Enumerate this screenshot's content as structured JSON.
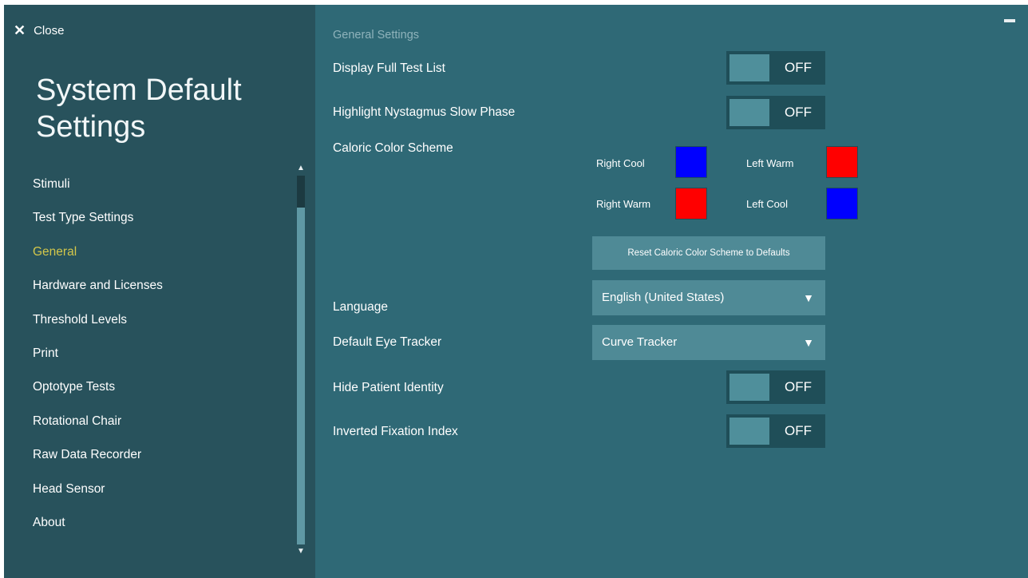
{
  "header": {
    "close_icon": "✕",
    "close_label": "Close",
    "title": "System Default Settings",
    "minimize_icon": "minimize-icon"
  },
  "sidebar": {
    "items": [
      {
        "label": "Stimuli",
        "active": false
      },
      {
        "label": "Test Type Settings",
        "active": false
      },
      {
        "label": "General",
        "active": true
      },
      {
        "label": "Hardware and Licenses",
        "active": false
      },
      {
        "label": "Threshold Levels",
        "active": false
      },
      {
        "label": "Print",
        "active": false
      },
      {
        "label": "Optotype Tests",
        "active": false
      },
      {
        "label": "Rotational Chair",
        "active": false
      },
      {
        "label": "Raw Data Recorder",
        "active": false
      },
      {
        "label": "Head Sensor",
        "active": false
      },
      {
        "label": "About",
        "active": false
      }
    ],
    "scroll_up_icon": "▲",
    "scroll_down_icon": "▼"
  },
  "main": {
    "section_title": "General Settings",
    "display_full_test_list": {
      "label": "Display Full Test List",
      "state": "OFF"
    },
    "highlight_nystagmus": {
      "label": "Highlight Nystagmus Slow Phase",
      "state": "OFF"
    },
    "caloric_color_scheme": {
      "label": "Caloric Color Scheme",
      "right_cool": {
        "label": "Right Cool",
        "color": "#0000ff"
      },
      "left_warm": {
        "label": "Left Warm",
        "color": "#ff0000"
      },
      "right_warm": {
        "label": "Right Warm",
        "color": "#ff0000"
      },
      "left_cool": {
        "label": "Left Cool",
        "color": "#0000ff"
      },
      "reset_label": "Reset Caloric Color Scheme to Defaults"
    },
    "language": {
      "label": "Language",
      "value": "English (United States)"
    },
    "default_eye_tracker": {
      "label": "Default Eye Tracker",
      "value": "Curve Tracker"
    },
    "hide_patient_identity": {
      "label": "Hide Patient Identity",
      "state": "OFF"
    },
    "inverted_fixation_index": {
      "label": "Inverted Fixation Index",
      "state": "OFF"
    },
    "dropdown_arrow": "▼"
  },
  "colors": {
    "accent": "#d4c74a",
    "sidebar_bg": "#28525c",
    "content_bg": "#2f6976"
  }
}
